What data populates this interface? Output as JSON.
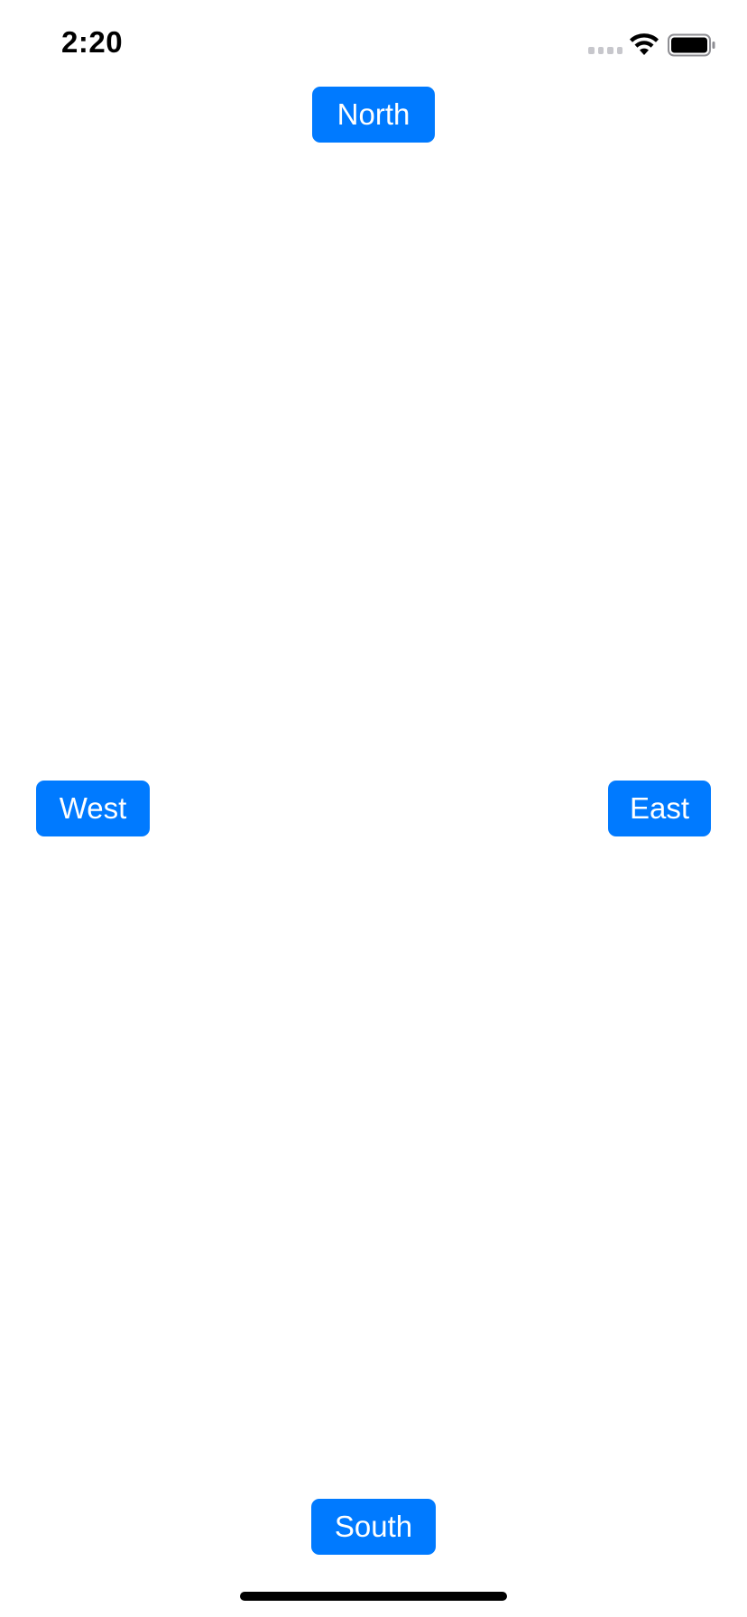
{
  "status_bar": {
    "time": "2:20",
    "icons": [
      "cellular-signal-icon",
      "wifi-icon",
      "battery-icon"
    ]
  },
  "buttons": {
    "north": "North",
    "west": "West",
    "east": "East",
    "south": "South"
  },
  "colors": {
    "accent": "#007aff",
    "button_text": "#ffffff",
    "background": "#ffffff"
  }
}
